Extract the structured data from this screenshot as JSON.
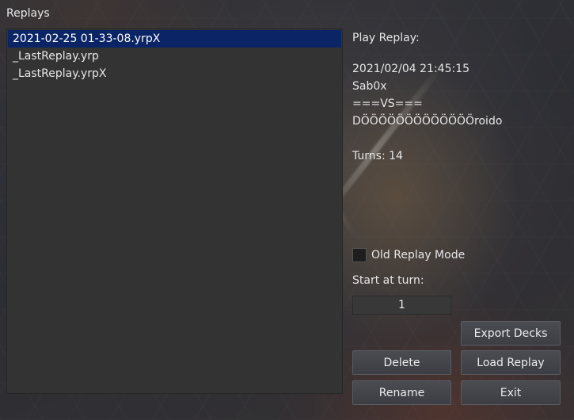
{
  "window": {
    "title": "Replays"
  },
  "replay_list": {
    "items": [
      {
        "label": "2021-02-25 01-33-08.yrpX",
        "selected": true
      },
      {
        "label": "_LastReplay.yrp",
        "selected": false
      },
      {
        "label": "_LastReplay.yrpX",
        "selected": false
      }
    ]
  },
  "info": {
    "header": "Play Replay:",
    "date": "2021/02/04 21:45:15",
    "player1": "Sab0x",
    "vs": "===VS===",
    "player2": "DÖÖÖÖÖÖÖÖÖÖÖÖÖroido",
    "blank": "",
    "turns": "Turns: 14"
  },
  "options": {
    "old_replay_mode_label": "Old Replay Mode",
    "old_replay_mode_checked": false,
    "start_at_turn_label": "Start at turn:",
    "start_at_turn_value": "1"
  },
  "buttons": {
    "export_decks": "Export Decks",
    "delete": "Delete",
    "load_replay": "Load Replay",
    "rename": "Rename",
    "exit": "Exit"
  }
}
